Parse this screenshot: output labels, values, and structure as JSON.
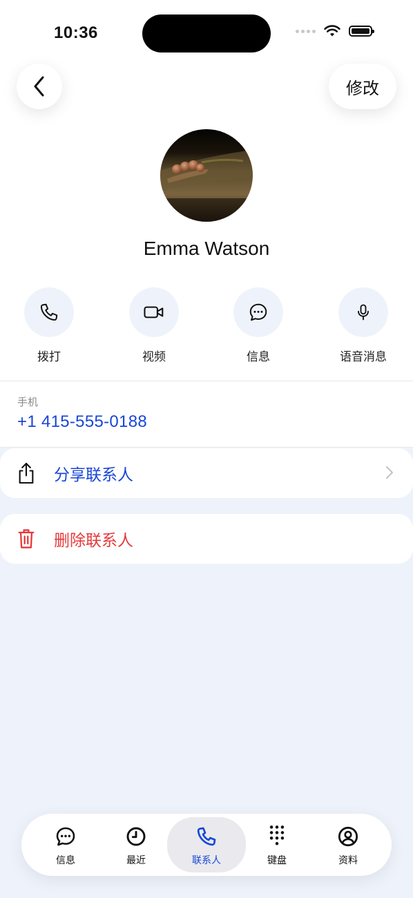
{
  "status_bar": {
    "time": "10:36"
  },
  "header": {
    "edit_label": "修改"
  },
  "contact": {
    "name": "Emma Watson"
  },
  "actions": [
    {
      "label": "拨打",
      "icon": "phone-icon"
    },
    {
      "label": "视频",
      "icon": "video-icon"
    },
    {
      "label": "信息",
      "icon": "message-icon"
    },
    {
      "label": "语音消息",
      "icon": "mic-icon"
    }
  ],
  "phone": {
    "label": "手机",
    "number": "+1 415-555-0188"
  },
  "share": {
    "label": "分享联系人"
  },
  "delete": {
    "label": "删除联系人"
  },
  "tabs": [
    {
      "label": "信息",
      "icon": "chat-icon"
    },
    {
      "label": "最近",
      "icon": "clock-icon"
    },
    {
      "label": "联系人",
      "icon": "phone-icon",
      "active": true
    },
    {
      "label": "键盘",
      "icon": "keypad-icon"
    },
    {
      "label": "资料",
      "icon": "profile-icon"
    }
  ],
  "colors": {
    "accent": "#1846d6",
    "danger": "#e5393b",
    "background": "#eef3fb"
  }
}
